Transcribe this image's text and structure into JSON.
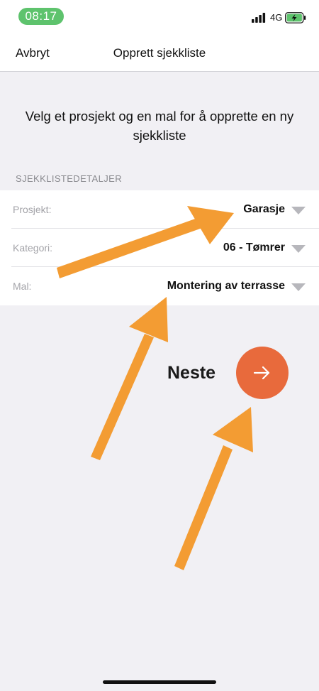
{
  "status_bar": {
    "time": "08:17",
    "network": "4G",
    "colors": {
      "time_pill": "#5ec36d",
      "battery_fill": "#5ec36d"
    }
  },
  "nav": {
    "cancel_label": "Avbryt",
    "title": "Opprett sjekkliste"
  },
  "intro": {
    "text": "Velg et prosjekt og en mal for å opprette en ny sjekkliste"
  },
  "section": {
    "header": "SJEKKLISTEDETALJER"
  },
  "form": {
    "rows": [
      {
        "label": "Prosjekt:",
        "value": "Garasje"
      },
      {
        "label": "Kategori:",
        "value": "06 - Tømrer"
      },
      {
        "label": "Mal:",
        "value": "Montering av terrasse"
      }
    ]
  },
  "actions": {
    "next_label": "Neste",
    "next_icon": "arrow-right-icon",
    "colors": {
      "next_button": "#e86a3c"
    }
  },
  "annotation": {
    "arrow_color": "#f39c33"
  }
}
